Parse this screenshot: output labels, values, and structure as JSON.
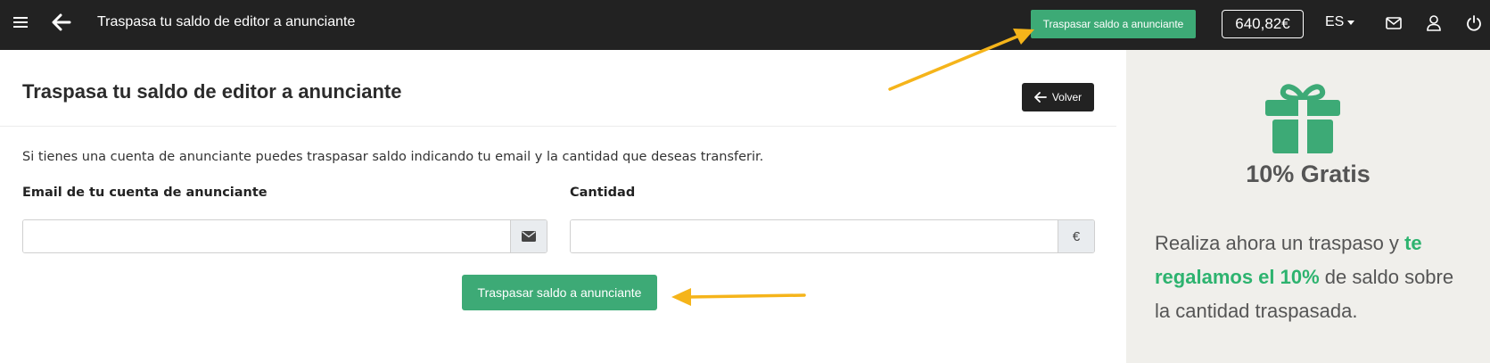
{
  "topbar": {
    "title": "Traspasa tu saldo de editor a anunciante",
    "transfer_button": "Traspasar saldo a anunciante",
    "balance": "640,82€",
    "language": "ES"
  },
  "card": {
    "title": "Traspasa tu saldo de editor a anunciante",
    "back_button": "Volver",
    "description": "Si tienes una cuenta de anunciante puedes traspasar saldo indicando tu email y la cantidad que deseas transferir.",
    "email_label": "Email de tu cuenta de anunciante",
    "email_value": "",
    "quantity_label": "Cantidad",
    "quantity_value": "",
    "currency_symbol": "€",
    "submit_button": "Traspasar saldo a anunciante"
  },
  "promo": {
    "title": "10% Gratis",
    "text_before": "Realiza ahora un traspaso y ",
    "text_highlight": "te regalamos el 10%",
    "text_after": " de saldo sobre la cantidad traspasada."
  },
  "colors": {
    "topbar_bg": "#222222",
    "accent_green": "#3daa76",
    "highlight_green": "#2db36f",
    "annotation_arrow": "#f5b41a",
    "promo_bg": "#f0efeb"
  }
}
